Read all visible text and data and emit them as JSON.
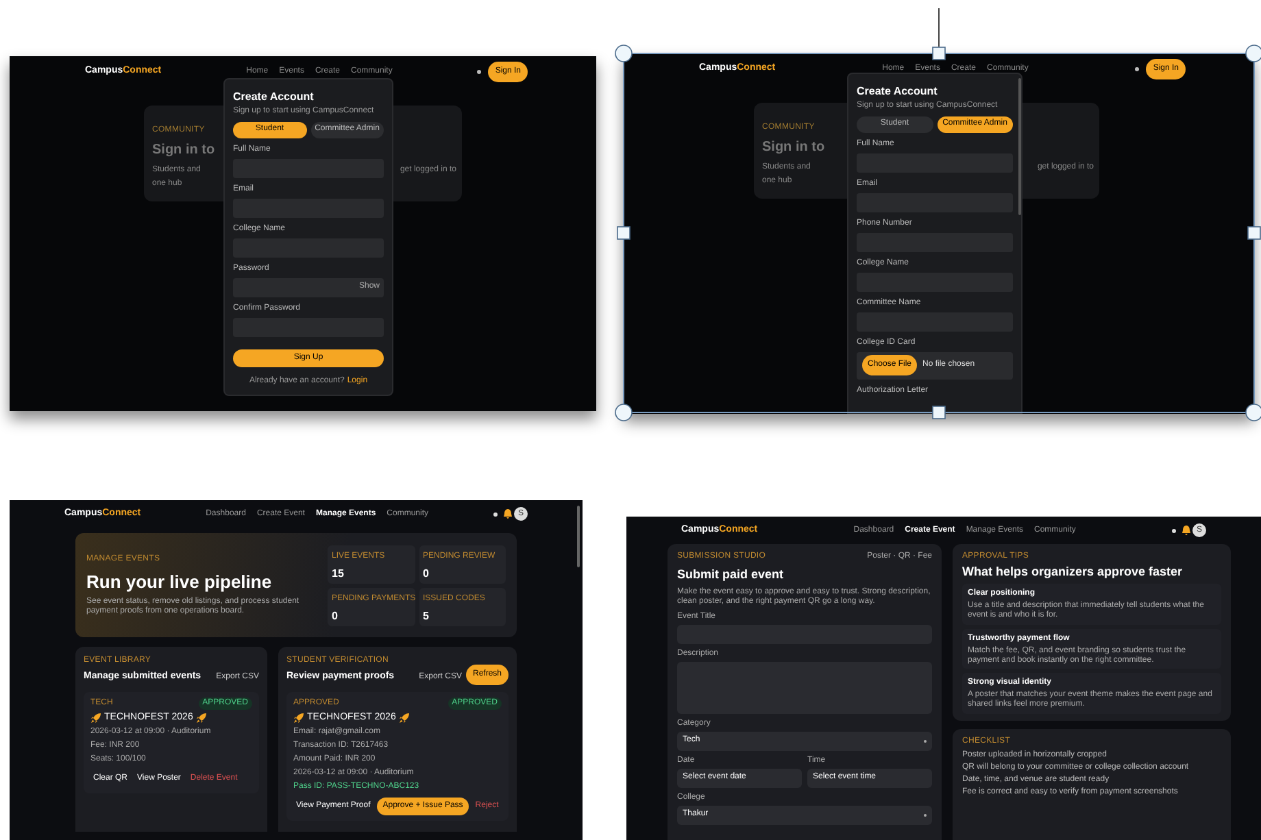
{
  "screens": [
    {
      "kind": "signup",
      "selected": false,
      "brand": [
        "Campus",
        "Connect"
      ],
      "nav": [
        "Home",
        "Events",
        "Create",
        "Community"
      ],
      "nav_button": "Sign In",
      "backdrop": {
        "eyebrow": "COMMUNITY",
        "title": "Sign in to",
        "text_left": "Students and",
        "text_right": "get logged in to",
        "text_left_2": "one hub"
      },
      "modal": {
        "title": "Create Account",
        "subtitle": "Sign up to start using CampusConnect",
        "roles": [
          {
            "label": "Student",
            "selected": true
          },
          {
            "label": "Committee Admin",
            "selected": false
          }
        ],
        "fields": [
          {
            "kind": "text",
            "label": "Full Name"
          },
          {
            "kind": "text",
            "label": "Email"
          },
          {
            "kind": "text",
            "label": "College Name"
          },
          {
            "kind": "password",
            "label": "Password",
            "action": "Show"
          },
          {
            "kind": "text",
            "label": "Confirm Password"
          }
        ],
        "submit": "Sign Up",
        "footer": "Already have an account?",
        "footer_link": "Login"
      }
    },
    {
      "kind": "signup",
      "selected": true,
      "brand": [
        "Campus",
        "Connect"
      ],
      "nav": [
        "Home",
        "Events",
        "Create",
        "Community"
      ],
      "nav_button": "Sign In",
      "backdrop": {
        "eyebrow": "COMMUNITY",
        "title": "Sign in to",
        "text_left": "Students and",
        "text_right": "get logged in to",
        "text_left_2": "one hub"
      },
      "modal": {
        "title": "Create Account",
        "subtitle": "Sign up to start using CampusConnect",
        "roles": [
          {
            "label": "Student",
            "selected": false
          },
          {
            "label": "Committee Admin",
            "selected": true
          }
        ],
        "fields": [
          {
            "kind": "text",
            "label": "Full Name"
          },
          {
            "kind": "text",
            "label": "Email"
          },
          {
            "kind": "text",
            "label": "Phone Number"
          },
          {
            "kind": "text",
            "label": "College Name"
          },
          {
            "kind": "text",
            "label": "Committee Name"
          },
          {
            "kind": "file",
            "label": "College ID Card",
            "button": "Choose File",
            "value": "No file chosen"
          },
          {
            "kind": "cut",
            "label": "Authorization Letter"
          }
        ]
      }
    },
    {
      "kind": "manage",
      "selected": false,
      "brand": [
        "Campus",
        "Connect"
      ],
      "nav": [
        {
          "label": "Dashboard",
          "selected": false
        },
        {
          "label": "Create Event",
          "selected": false
        },
        {
          "label": "Manage Events",
          "selected": true
        },
        {
          "label": "Community",
          "selected": false
        }
      ],
      "avatar": "S",
      "hero": {
        "eyebrow": "MANAGE EVENTS",
        "title": "Run your live pipeline",
        "text": "See event status, remove old listings, and process student payment proofs from one operations board.",
        "stats": [
          {
            "label": "LIVE EVENTS",
            "value": "15"
          },
          {
            "label": "PENDING REVIEW",
            "value": "0"
          },
          {
            "label": "PENDING PAYMENTS",
            "value": "0"
          },
          {
            "label": "ISSUED CODES",
            "value": "5"
          }
        ]
      },
      "cards": [
        {
          "eyebrow": "EVENT LIBRARY",
          "title": "Manage submitted events",
          "link": "Export CSV",
          "item": {
            "tag": "TECH",
            "badge": "APPROVED",
            "title": "TECHNOFEST 2026",
            "lines": [
              "2026-03-12 at 09:00 · Auditorium",
              "Fee: INR 200",
              "Seats: 100/100"
            ],
            "actions": [
              {
                "label": "Clear QR",
                "kind": "plain"
              },
              {
                "label": "View Poster",
                "kind": "plain"
              },
              {
                "label": "Delete Event",
                "kind": "danger"
              }
            ]
          }
        },
        {
          "eyebrow": "STUDENT VERIFICATION",
          "title": "Review payment proofs",
          "link": "Export CSV",
          "button": "Refresh",
          "item": {
            "tag": "APPROVED",
            "badge": "APPROVED",
            "title": "TECHNOFEST 2026",
            "lines": [
              "Email: rajat@gmail.com",
              "Transaction ID: T2617463",
              "Amount Paid: INR 200",
              "2026-03-12 at 09:00 · Auditorium"
            ],
            "pass": "Pass ID: PASS-TECHNO-ABC123",
            "actions": [
              {
                "label": "View Payment Proof",
                "kind": "plain"
              },
              {
                "label": "Approve + Issue Pass",
                "kind": "primary"
              },
              {
                "label": "Reject",
                "kind": "danger"
              }
            ]
          }
        }
      ]
    },
    {
      "kind": "create",
      "selected": false,
      "brand": [
        "Campus",
        "Connect"
      ],
      "nav": [
        {
          "label": "Dashboard",
          "selected": false
        },
        {
          "label": "Create Event",
          "selected": true
        },
        {
          "label": "Manage Events",
          "selected": false
        },
        {
          "label": "Community",
          "selected": false
        }
      ],
      "avatar": "S",
      "form": {
        "eyebrow": "SUBMISSION STUDIO",
        "meta": "Poster · QR · Fee",
        "title": "Submit paid event",
        "text": "Make the event easy to approve and easy to trust. Strong description, clean poster, and the right payment QR go a long way.",
        "fields": [
          {
            "kind": "text",
            "label": "Event Title"
          },
          {
            "kind": "textarea",
            "label": "Description"
          },
          {
            "kind": "select",
            "label": "Category",
            "value": "Tech"
          },
          {
            "kind": "pair",
            "items": [
              {
                "label": "Date",
                "value": "Select event date"
              },
              {
                "label": "Time",
                "value": "Select event time"
              }
            ]
          },
          {
            "kind": "select",
            "label": "College",
            "value": "Thakur"
          }
        ]
      },
      "tips": {
        "eyebrow": "APPROVAL TIPS",
        "title": "What helps organizers approve faster",
        "items": [
          {
            "title": "Clear positioning",
            "text": "Use a title and description that immediately tell students what the event is and who it is for."
          },
          {
            "title": "Trustworthy payment flow",
            "text": "Match the fee, QR, and event branding so students trust the payment and book instantly on the right committee."
          },
          {
            "title": "Strong visual identity",
            "text": "A poster that matches your event theme makes the event page and shared links feel more premium."
          }
        ]
      },
      "checklist": {
        "eyebrow": "CHECKLIST",
        "items": [
          "Poster uploaded in horizontally cropped",
          "QR will belong to your committee or college collection account",
          "Date, time, and venue are student ready",
          "Fee is correct and easy to verify from payment screenshots"
        ]
      }
    }
  ]
}
